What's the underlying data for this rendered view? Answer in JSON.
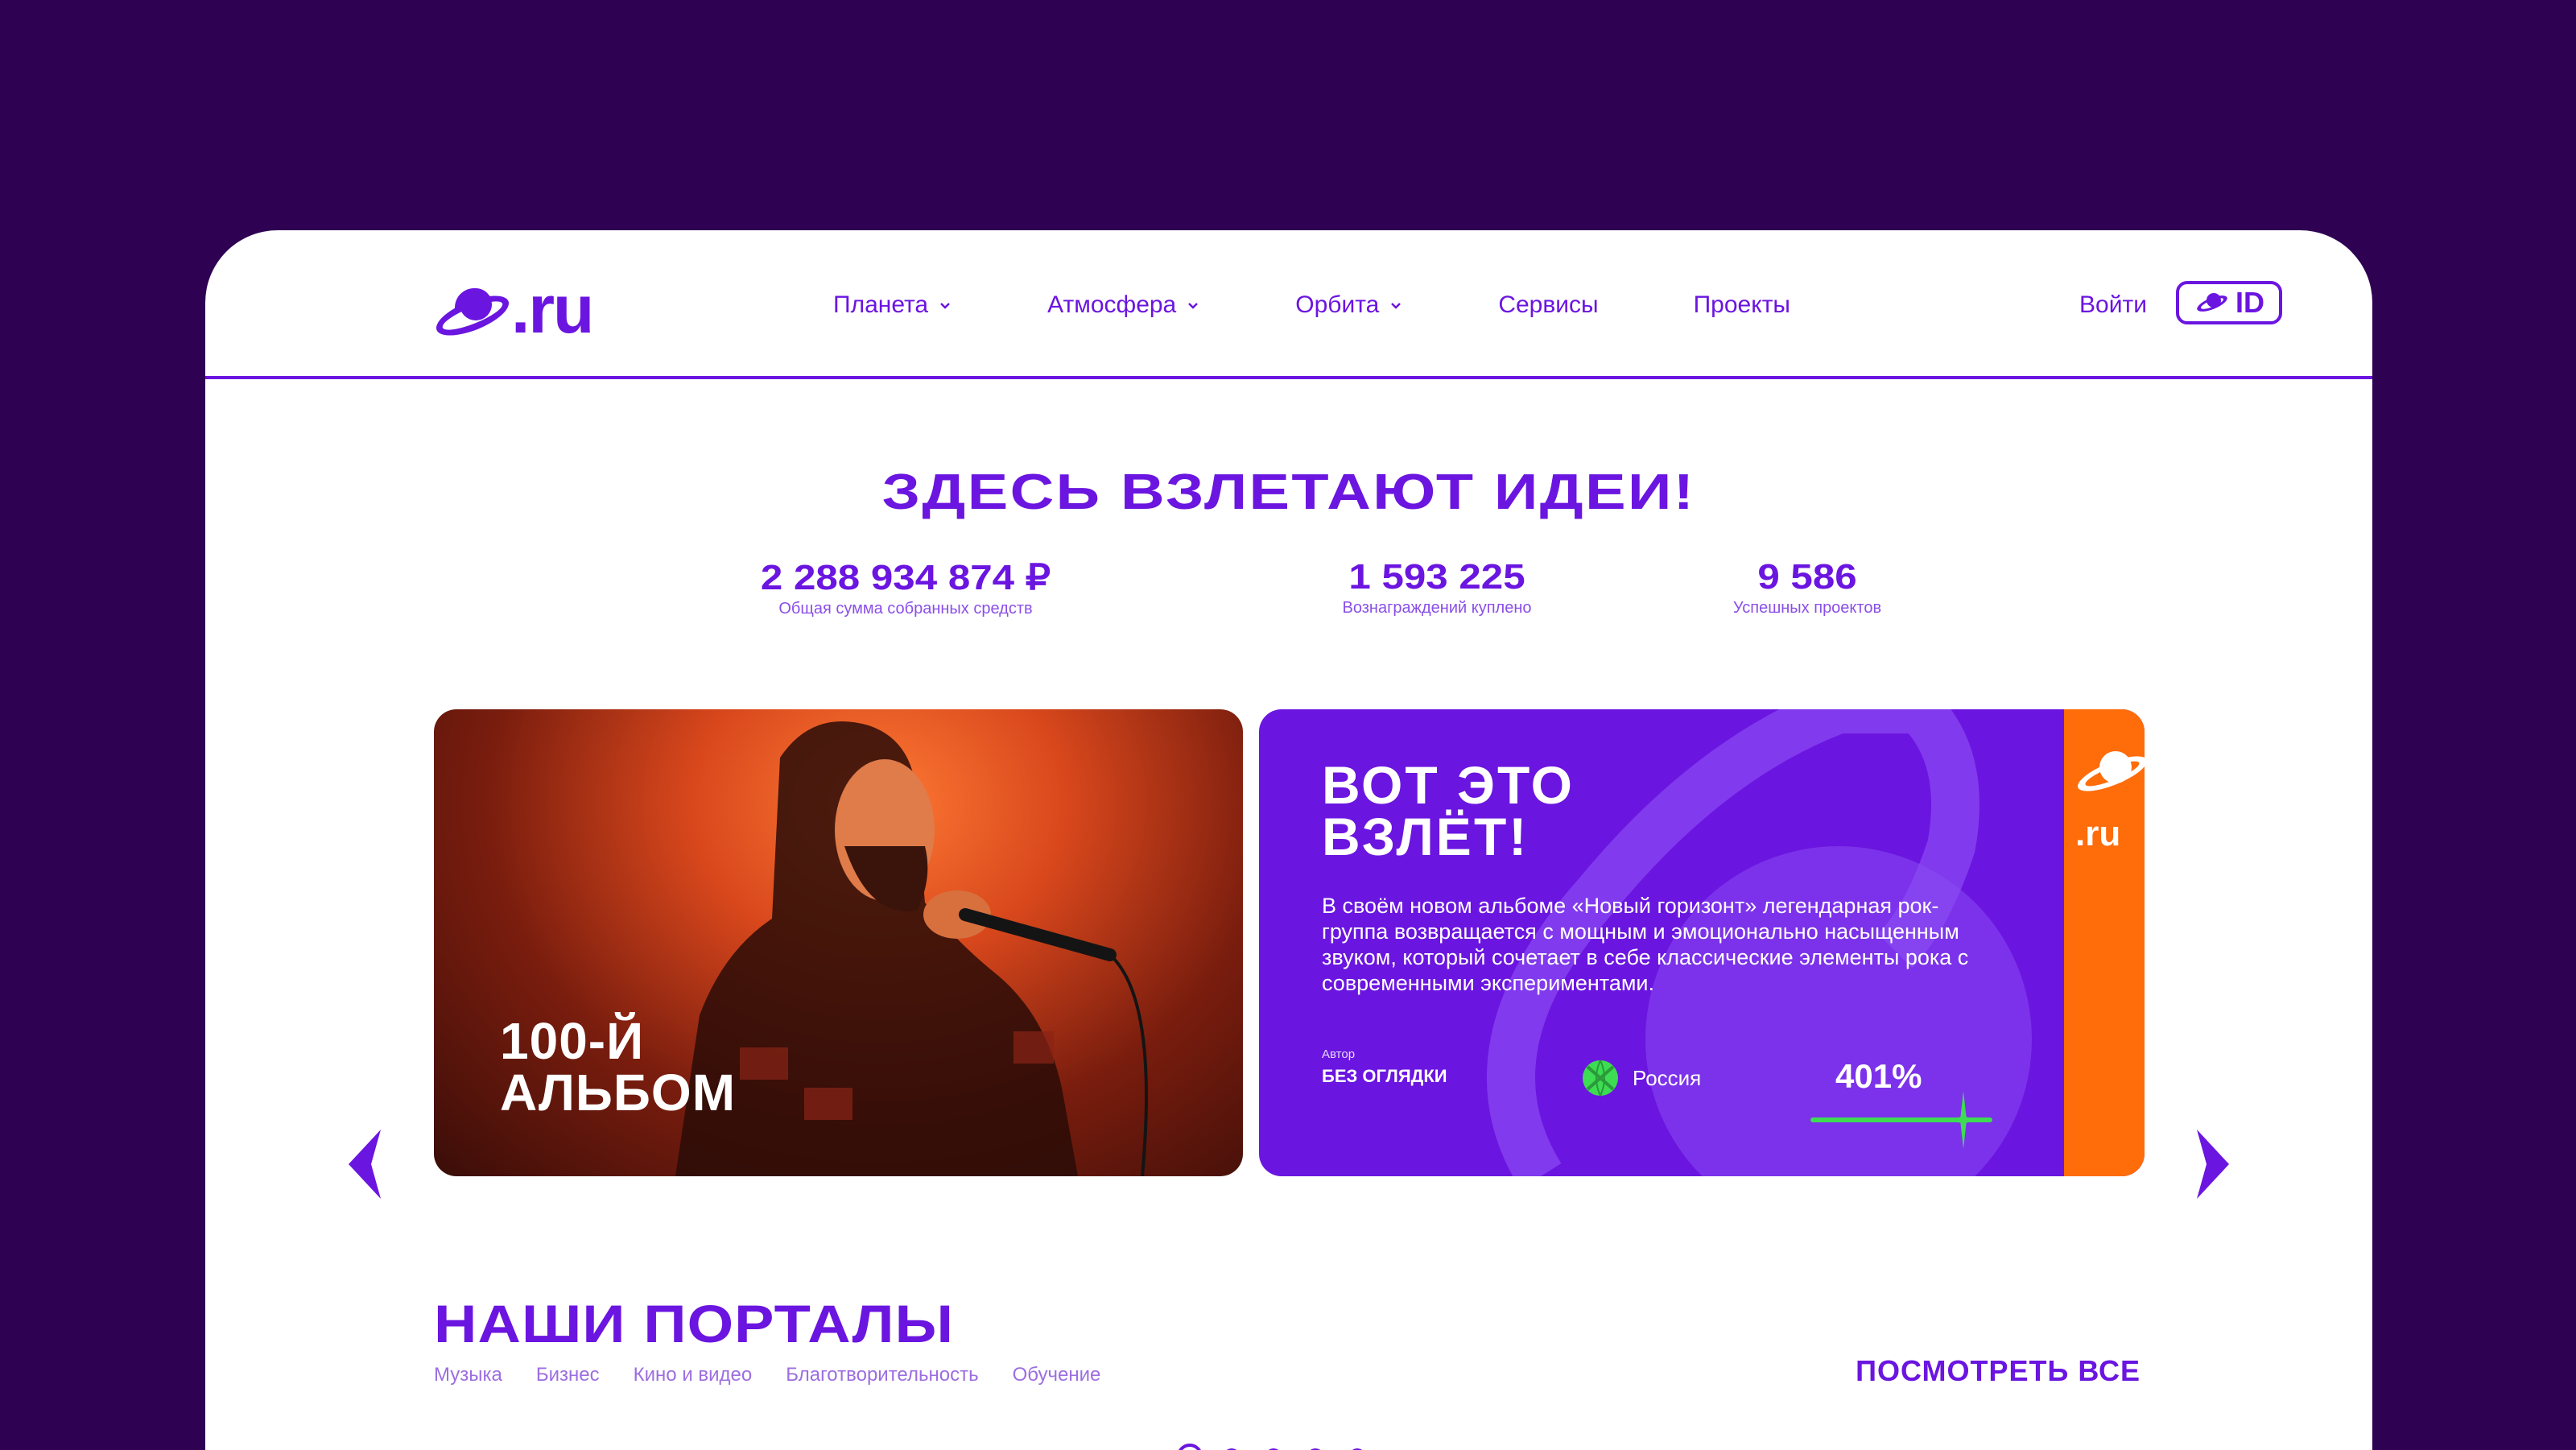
{
  "header": {
    "logo_text": ".ru",
    "nav": [
      {
        "label": "Планета",
        "dropdown": true
      },
      {
        "label": "Атмосфера",
        "dropdown": true
      },
      {
        "label": "Орбита",
        "dropdown": true
      },
      {
        "label": "Сервисы",
        "dropdown": false
      },
      {
        "label": "Проекты",
        "dropdown": false
      }
    ],
    "login_label": "Войти",
    "id_label": "ID"
  },
  "hero": {
    "title": "ЗДЕСЬ ВЗЛЕТАЮТ ИДЕИ!",
    "stats": [
      {
        "value": "2 288 934 874 ₽",
        "label": "Общая сумма собранных средств"
      },
      {
        "value": "1 593 225",
        "label": "Вознаграждений куплено"
      },
      {
        "value": "9 586",
        "label": "Успешных проектов"
      }
    ]
  },
  "slide": {
    "image_caption_line1": "100-Й",
    "image_caption_line2": "АЛЬБОМ",
    "title_line1": "ВОТ ЭТО",
    "title_line2": "ВЗЛЁТ!",
    "description": "В своём новом альбоме «Новый горизонт» легендарная рок-группа возвращается с мощным и эмоционально насыщенным звуком, который сочетает в себе классические элементы рока с современными экспериментами.",
    "author_label": "Автор",
    "author": "БЕЗ ОГЛЯДКИ",
    "country": "Россия",
    "percent": "401%",
    "progress_fraction": 0.85,
    "badge_text": ".ru",
    "dots_total": 5,
    "active_dot": 1
  },
  "portals": {
    "title": "НАШИ ПОРТАЛЫ",
    "links": [
      "Музыка",
      "Бизнес",
      "Кино и видео",
      "Благотворительность",
      "Обучение"
    ],
    "see_all": "ПОСМОТРЕТЬ ВСЕ"
  },
  "colors": {
    "brand": "#6b15e0",
    "background": "#2e0153",
    "accent_orange": "#ff6c0a",
    "progress_green": "#3ddc52"
  }
}
